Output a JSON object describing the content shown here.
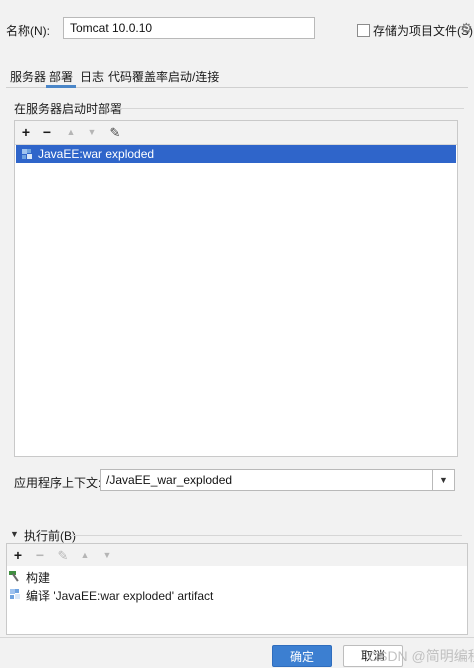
{
  "name_row": {
    "label": "名称(N):",
    "value": "Tomcat 10.0.10",
    "store_label": "存储为项目文件(S)",
    "store_checked": false
  },
  "tabs": [
    {
      "label": "服务器",
      "active": false
    },
    {
      "label": "部署",
      "active": true
    },
    {
      "label": "日志",
      "active": false
    },
    {
      "label": "代码覆盖率",
      "active": false
    },
    {
      "label": "启动/连接",
      "active": false
    }
  ],
  "deploy": {
    "title": "在服务器启动时部署",
    "toolbar": {
      "add": "+",
      "remove": "−",
      "up": "▲",
      "down": "▼",
      "edit": "✎"
    },
    "items": [
      {
        "label": "JavaEE:war exploded",
        "selected": true
      }
    ]
  },
  "context": {
    "label": "应用程序上下文:",
    "value": "/JavaEE_war_exploded",
    "dropdown": "▼"
  },
  "before_launch": {
    "arrow": "▼",
    "label": "执行前(B)",
    "toolbar": {
      "add": "+",
      "remove": "−",
      "edit": "✎",
      "up": "▲",
      "down": "▼"
    },
    "items": [
      {
        "label": "构建",
        "icon": "hammer-icon"
      },
      {
        "label": "编译 'JavaEE:war exploded' artifact",
        "icon": "artifact-icon"
      }
    ]
  },
  "footer": {
    "ok": "确定",
    "cancel": "取消",
    "watermark": "CSDN @简明编程"
  },
  "colors": {
    "accent": "#3c7fd1",
    "selection": "#2f65ca",
    "tab_underline": "#4a86c8"
  }
}
